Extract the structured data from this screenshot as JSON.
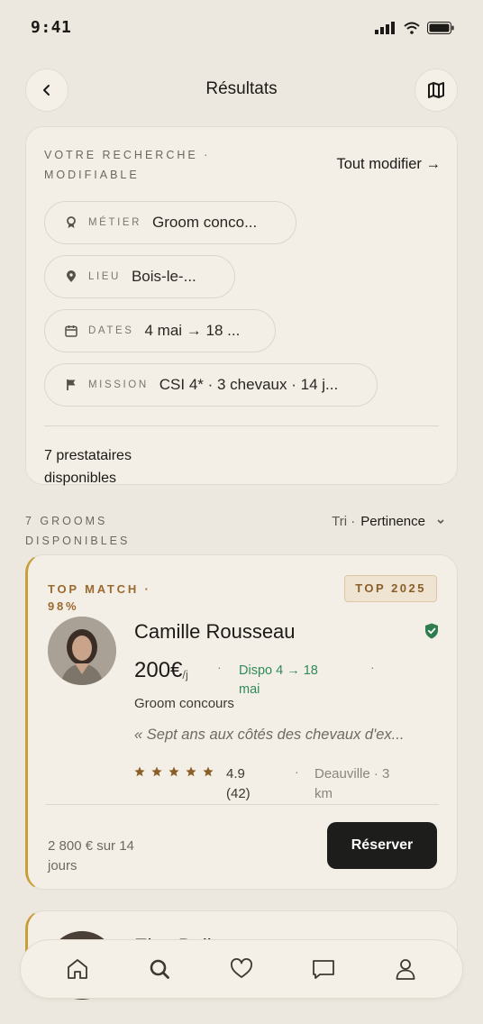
{
  "status": {
    "time": "9:41"
  },
  "header": {
    "title": "Résultats",
    "back_icon": "chevron-left-icon",
    "map_icon": "map-icon"
  },
  "search": {
    "heading_line1": "VOTRE RECHERCHE ·",
    "heading_line2": "MODIFIABLE",
    "modify_label": "Tout modifier →",
    "chips": [
      {
        "icon": "award-icon",
        "key": "MÉTIER",
        "value": "Groom conco..."
      },
      {
        "icon": "map-pin-icon",
        "key": "LIEU",
        "value": "Bois-le-..."
      },
      {
        "icon": "calendar-icon",
        "key": "DATES",
        "value": "4 mai → 18 ..."
      },
      {
        "icon": "flag-icon",
        "key": "MISSION",
        "value": "CSI 4* · 3 chevaux · 14 j..."
      }
    ],
    "available_line1": "7 prestataires",
    "available_line2": "disponibles"
  },
  "results_header": {
    "count_line1": "7 GROOMS",
    "count_line2": "DISPONIBLES",
    "sort_prefix": "Tri ·",
    "sort_value": "Pertinence"
  },
  "card": {
    "match_line1": "TOP MATCH ·",
    "match_line2": "98%",
    "badge": "TOP 2025",
    "name": "Camille Rousseau",
    "price": "200€",
    "price_unit": "/j",
    "availability_line1": "Dispo 4 → 18",
    "availability_line2": "mai",
    "role": "Groom concours",
    "quote": "« Sept ans aux côtés des chevaux d'ex...",
    "rating_stars": 5,
    "rating": "4.9",
    "reviews": "(42)",
    "location_line1": "Deauville · 3",
    "location_line2": "km",
    "total_line1": "2 800 € sur 14",
    "total_line2": "jours",
    "reserve_label": "Réserver"
  },
  "next_card": {
    "name_partial": "Elsa Bell"
  },
  "colors": {
    "background": "#ede8df",
    "accent_gold": "#c89e3a",
    "match_brown": "#8a5e28",
    "dispo_green": "#2f8a5a",
    "verified_green": "#2f7d4f",
    "button_dark": "#1d1d1b"
  },
  "tabbar": {
    "items": [
      "home-icon",
      "search-icon",
      "heart-icon",
      "message-icon",
      "user-icon"
    ]
  }
}
